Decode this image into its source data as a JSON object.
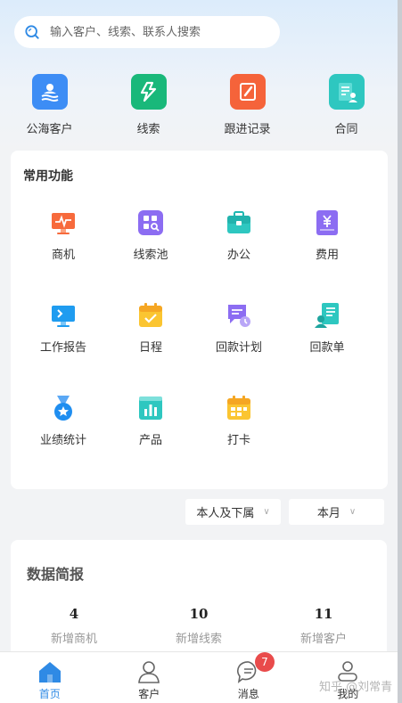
{
  "search": {
    "placeholder": "输入客户、线索、联系人搜索"
  },
  "quick_entries": [
    {
      "label": "公海客户",
      "icon": "public-sea-customer-icon",
      "color": "#3d8df5"
    },
    {
      "label": "线索",
      "icon": "lead-lightning-icon",
      "color": "#19b87a"
    },
    {
      "label": "跟进记录",
      "icon": "follow-up-record-icon",
      "color": "#f5633a"
    },
    {
      "label": "合同",
      "icon": "contract-icon",
      "color": "#2ec7c0"
    }
  ],
  "common_functions": {
    "title": "常用功能",
    "items": [
      {
        "label": "商机",
        "icon": "opportunity-icon"
      },
      {
        "label": "线索池",
        "icon": "lead-pool-icon"
      },
      {
        "label": "办公",
        "icon": "office-briefcase-icon"
      },
      {
        "label": "费用",
        "icon": "expense-icon"
      },
      {
        "label": "工作报告",
        "icon": "work-report-icon"
      },
      {
        "label": "日程",
        "icon": "schedule-calendar-icon"
      },
      {
        "label": "回款计划",
        "icon": "payment-plan-icon"
      },
      {
        "label": "回款单",
        "icon": "payment-receipt-icon"
      },
      {
        "label": "业绩统计",
        "icon": "performance-medal-icon"
      },
      {
        "label": "产品",
        "icon": "product-chart-icon"
      },
      {
        "label": "打卡",
        "icon": "check-in-icon"
      }
    ]
  },
  "filters": {
    "scope": "本人及下属",
    "period": "本月"
  },
  "stats": {
    "title": "数据简报",
    "items": [
      {
        "value": "4",
        "label": "新增商机"
      },
      {
        "value": "10",
        "label": "新增线索"
      },
      {
        "value": "11",
        "label": "新增客户"
      }
    ]
  },
  "tabbar": {
    "tabs": [
      {
        "label": "首页",
        "icon": "home-icon"
      },
      {
        "label": "客户",
        "icon": "customer-icon"
      },
      {
        "label": "消息",
        "icon": "message-icon",
        "badge": "7"
      },
      {
        "label": "我的",
        "icon": "profile-icon"
      }
    ]
  },
  "watermark": "知乎 @刘常青"
}
